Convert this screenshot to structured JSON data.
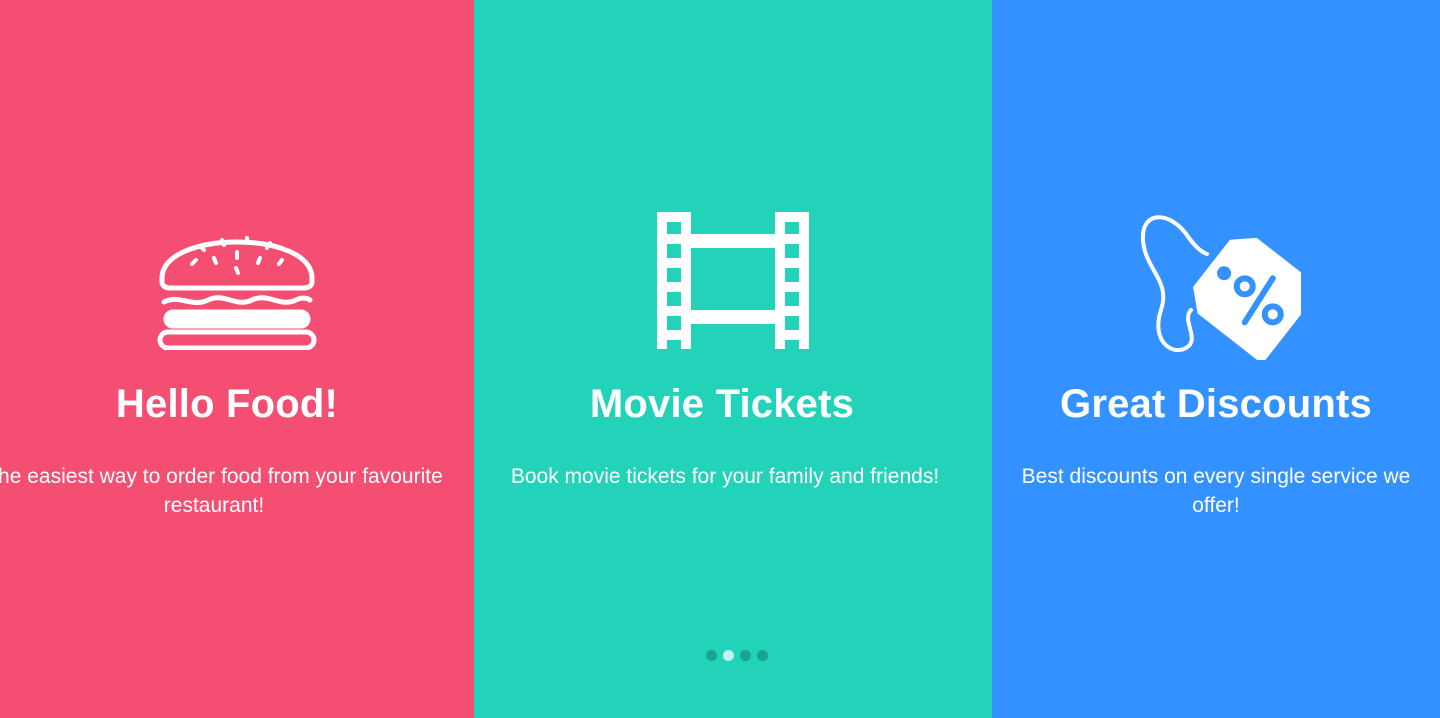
{
  "slides": [
    {
      "title": "Hello Food!",
      "description": "The easiest way to order food from your favourite restaurant!",
      "icon": "burger-icon",
      "background": "#f44e72"
    },
    {
      "title": "Movie Tickets",
      "description": "Book movie tickets for your family and friends!",
      "icon": "film-strip-icon",
      "background": "#22d2b9"
    },
    {
      "title": "Great Discounts",
      "description": "Best discounts on every single service we offer!",
      "icon": "discount-tag-icon",
      "background": "#3392ff"
    }
  ],
  "pagination": {
    "count": 4,
    "active_index": 1,
    "active_color": "#bff3ec",
    "inactive_color": "#15a592"
  }
}
